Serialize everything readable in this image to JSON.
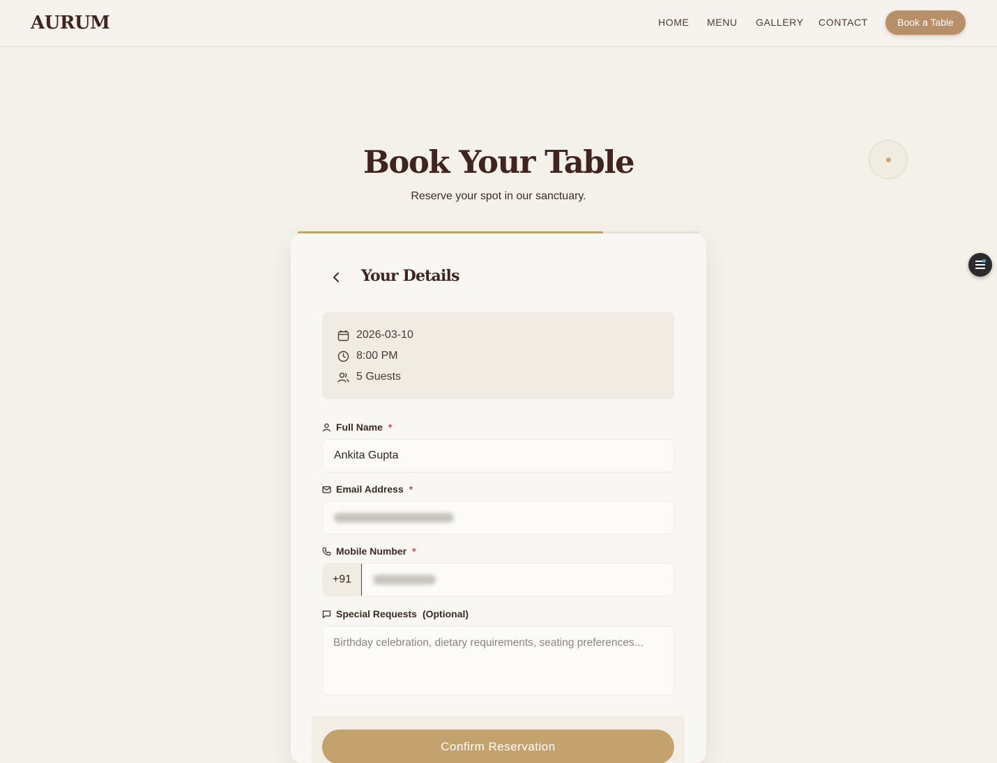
{
  "brand": {
    "logo": "AURUM"
  },
  "nav": {
    "items": [
      {
        "label": "HOME"
      },
      {
        "label": "MENU"
      },
      {
        "label": "GALLERY"
      },
      {
        "label": "CONTACT"
      }
    ],
    "cta_label": "Book a Table"
  },
  "hero": {
    "title": "Book Your Table",
    "subtitle": "Reserve your spot in our sanctuary."
  },
  "booking": {
    "progress_fraction": 0.76,
    "step_title": "Your Details",
    "summary": {
      "date": "2026-03-10",
      "time": "8:00 PM",
      "guests": "5 Guests"
    },
    "fields": {
      "full_name": {
        "label": "Full Name",
        "required_mark": "*",
        "value": "Ankita Gupta"
      },
      "email": {
        "label": "Email Address",
        "required_mark": "*",
        "value": ""
      },
      "mobile": {
        "label": "Mobile Number",
        "required_mark": "*",
        "prefix": "+91",
        "value": ""
      },
      "special_requests": {
        "label": "Special Requests",
        "optional_tag": "(Optional)",
        "placeholder": "Birthday celebration, dietary requirements, seating preferences..."
      }
    },
    "confirm_label": "Confirm Reservation"
  },
  "colors": {
    "accent": "#b78f69",
    "confirm": "#c4a26e",
    "heading": "#3f2420",
    "background": "#f4f1ea",
    "required": "#d24b4b"
  }
}
